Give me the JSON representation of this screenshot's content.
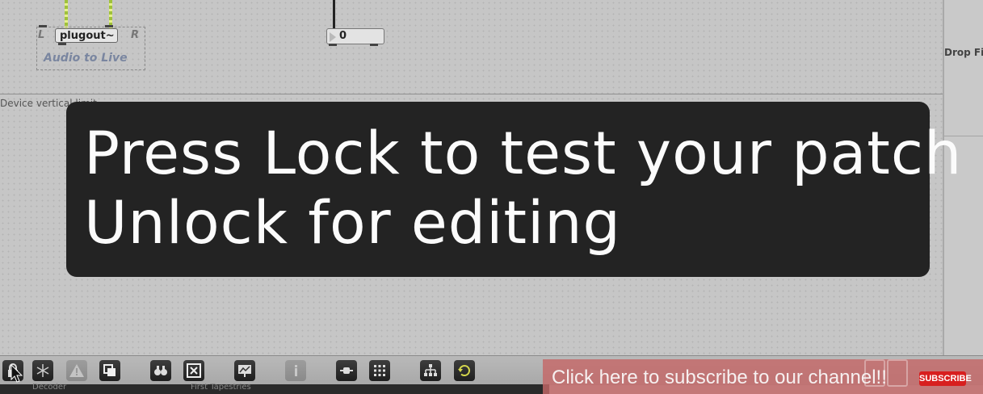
{
  "patcher": {
    "plugout_label": "plugout~",
    "left_port": "L",
    "right_port": "R",
    "audio_label": "Audio to Live",
    "number_value": "0",
    "device_limit_label": "Device vertical limit",
    "drop_label": "Drop Files"
  },
  "overlay": {
    "line1": "Press Lock to test your patch",
    "line2": "Unlock for editing"
  },
  "toolbar": {
    "buttons": [
      "lock-icon",
      "presentation-snowflake-icon",
      "warning-icon",
      "paste-layers-icon",
      "binoculars-icon",
      "close-box-icon",
      "debug-chart-icon",
      "info-icon",
      "toggle-connection-icon",
      "grid-icon",
      "hierarchy-icon",
      "refresh-icon"
    ]
  },
  "status": {
    "left_text": "Decoder",
    "right_text": "First Tapestries"
  },
  "subscribe": {
    "text": "Click here to subscribe to our channel!!",
    "badge": "SUBSCRIBE"
  },
  "colors": {
    "overlay_bg": "#232323",
    "subscribe_bg": "#c46868",
    "cable_green": "#9fc13a"
  }
}
